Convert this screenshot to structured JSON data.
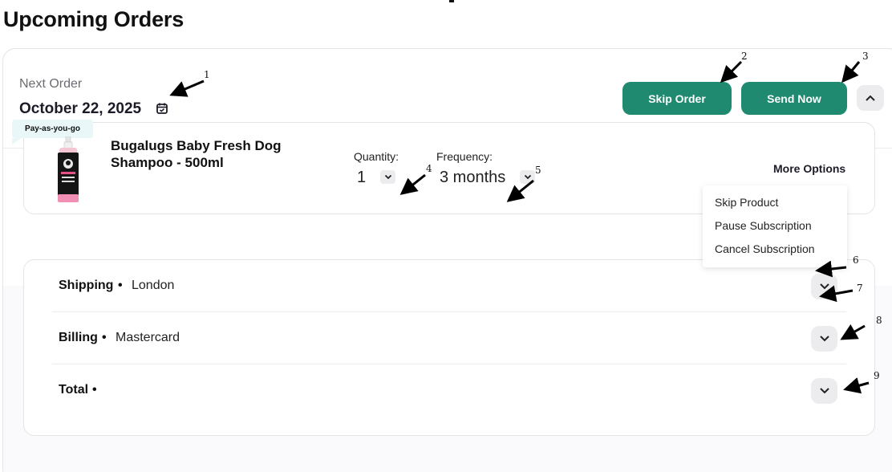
{
  "page": {
    "title": "Upcoming Orders"
  },
  "order": {
    "next_label": "Next Order",
    "next_date": "October 22, 2025",
    "skip_label": "Skip Order",
    "send_label": "Send Now"
  },
  "product": {
    "badge": "Pay-as-you-go",
    "name": "Bugalugs Baby Fresh Dog Shampoo - 500ml",
    "quantity_label": "Quantity:",
    "quantity_value": "1",
    "frequency_label": "Frequency:",
    "frequency_value": "3 months",
    "more_options_label": "More Options",
    "menu": [
      "Skip Product",
      "Pause Subscription",
      "Cancel Subscription"
    ]
  },
  "summary": {
    "rows": [
      {
        "key": "Shipping",
        "value": "London"
      },
      {
        "key": "Billing",
        "value": "Mastercard"
      },
      {
        "key": "Total",
        "value": ""
      }
    ],
    "separator": "•"
  },
  "annotations": [
    "1",
    "2",
    "3",
    "4",
    "5",
    "6",
    "7",
    "8",
    "9"
  ],
  "colors": {
    "accent": "#1f8a70",
    "badge_bg": "#e9f7f9",
    "chevron_bg": "#ececef"
  },
  "icons": [
    "calendar-check-icon",
    "chevron-up-icon",
    "chevron-down-icon",
    "product-bottle-image"
  ]
}
